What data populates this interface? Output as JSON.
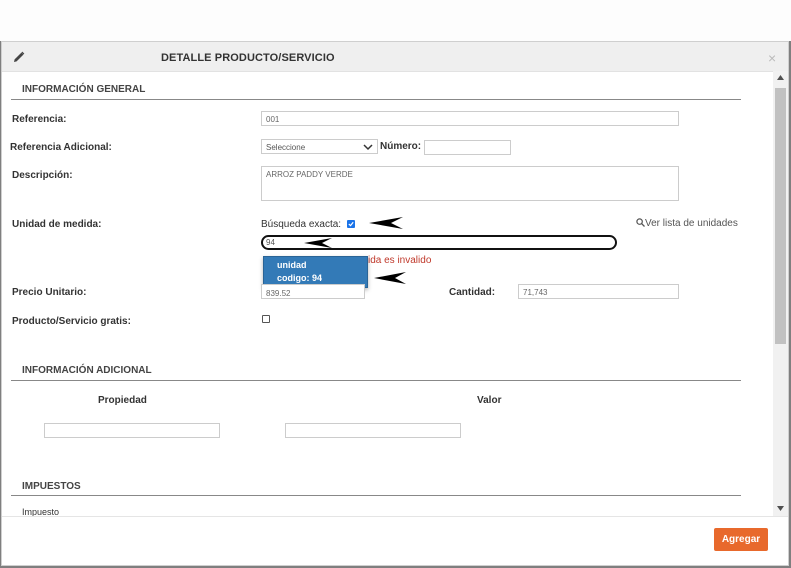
{
  "modal": {
    "title": "DETALLE PRODUCTO/SERVICIO",
    "close": "×"
  },
  "sections": {
    "general": "INFORMACIÓN GENERAL",
    "additional": "INFORMACIÓN ADICIONAL",
    "taxes": "IMPUESTOS"
  },
  "fields": {
    "referencia_label": "Referencia:",
    "referencia_value": "001",
    "ref_adicional_label": "Referencia Adicional:",
    "ref_adicional_select": "Seleccione",
    "numero_label": "Número:",
    "numero_value": "",
    "descripcion_label": "Descripción:",
    "descripcion_value": "ARROZ PADDY VERDE",
    "unidad_label": "Unidad de medida:",
    "busqueda_label": "Búsqueda exacta:",
    "busqueda_checked": true,
    "ver_lista": "Ver lista de unidades",
    "unidad_value": "94",
    "unidad_error": "ida es invalido",
    "precio_label": "Precio Unitario:",
    "precio_value": "839.52",
    "cantidad_label": "Cantidad:",
    "cantidad_value": "71,743",
    "gratis_label": "Producto/Servicio gratis:",
    "gratis_checked": false
  },
  "dropdown": {
    "line1": "unidad",
    "line2": "codigo: 94"
  },
  "additional_table": {
    "col_property": "Propiedad",
    "col_value": "Valor"
  },
  "taxes": {
    "col_impuesto": "Impuesto"
  },
  "footer": {
    "add_button": "Agregar"
  },
  "colors": {
    "accent_button": "#e8692c",
    "dropdown_highlight": "#337ab7",
    "error": "#c0392b"
  }
}
